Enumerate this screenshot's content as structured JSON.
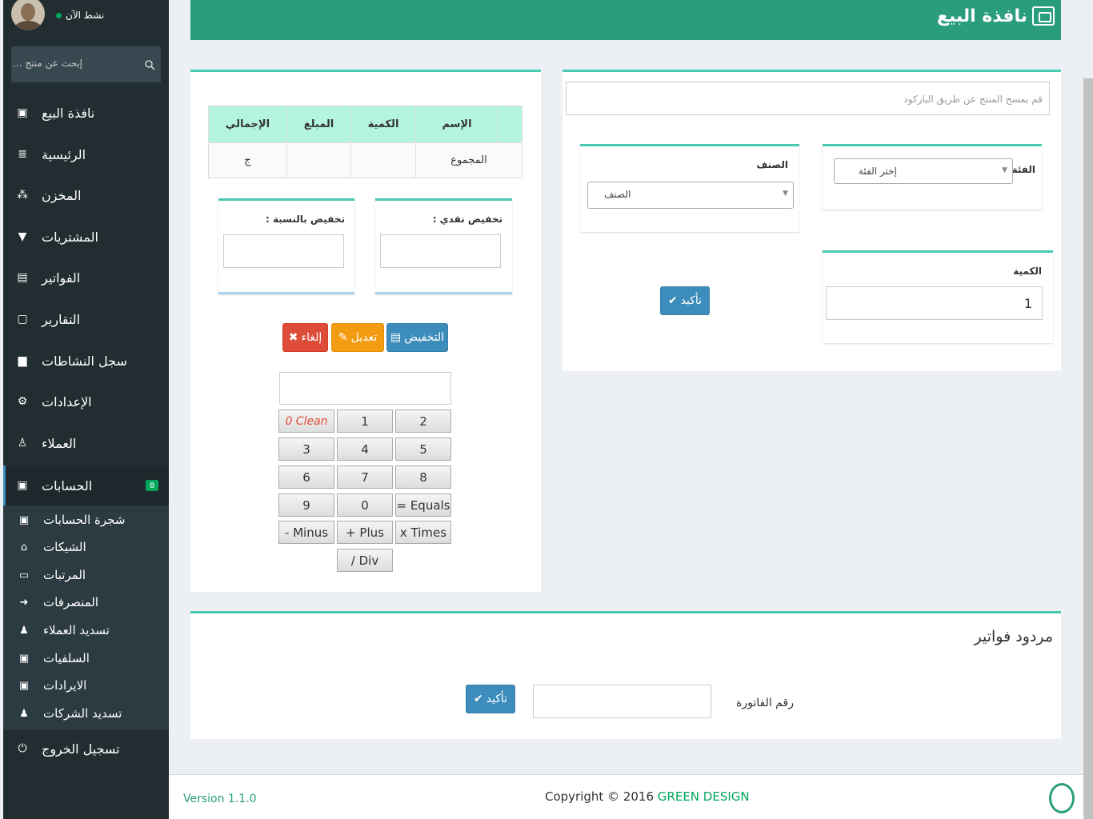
{
  "user": {
    "status": "نشط الآن"
  },
  "sidebar": {
    "search_placeholder": "إبحث عن منتج ...",
    "items": [
      {
        "label": "نافذة البيع",
        "icon": "register-icon"
      },
      {
        "label": "الرئيسية",
        "icon": "list-icon"
      },
      {
        "label": "المخزن",
        "icon": "boxes-icon"
      },
      {
        "label": "المشتريات",
        "icon": "cart-icon"
      },
      {
        "label": "الفواتير",
        "icon": "invoice-icon"
      },
      {
        "label": "التقارير",
        "icon": "file-icon"
      },
      {
        "label": "سجل النشاطات",
        "icon": "file-text-icon"
      },
      {
        "label": "الإعدادات",
        "icon": "gears-icon"
      },
      {
        "label": "العملاء",
        "icon": "person-icon"
      },
      {
        "label": "الحسابات",
        "icon": "money-icon",
        "badge": "8"
      }
    ],
    "sub_items": [
      {
        "label": "شجرة الحسابات",
        "icon": "money-icon"
      },
      {
        "label": "الشيكات",
        "icon": "bank-icon"
      },
      {
        "label": "المرتبات",
        "icon": "card-icon"
      },
      {
        "label": "المنصرفات",
        "icon": "sign-out-icon"
      },
      {
        "label": "تسديد العملاء",
        "icon": "users-icon"
      },
      {
        "label": "السلفيات",
        "icon": "money-icon"
      },
      {
        "label": "الايرادات",
        "icon": "money-icon"
      },
      {
        "label": "تسديد الشركات",
        "icon": "users-icon"
      }
    ],
    "logout": {
      "label": "تسجيل الخروج",
      "icon": "power-icon"
    }
  },
  "header": {
    "title": "نافذة البيع"
  },
  "sale": {
    "barcode_placeholder": "قم بمسح المنتج عن طريق الباركود",
    "category_label": "الفئة",
    "category_value": "إختر الفئة",
    "item_label": "الصنف",
    "item_value": "الصنف",
    "quantity_label": "الكمية",
    "quantity_value": "1",
    "confirm_label": "تأكيد"
  },
  "cart": {
    "headers": [
      "الإسم",
      "الكمية",
      "المبلغ",
      "الإجمالي"
    ],
    "total_label": "المجموع",
    "total_value": "ج",
    "discount_cash_label": "تخفيض نقدي :",
    "discount_percent_label": "تخفيض بالنسبة :",
    "btn_discount": "التخفيض",
    "btn_edit": "تعديل",
    "btn_cancel": "إلغاء"
  },
  "calculator": {
    "rows": [
      [
        "0 Clean",
        "1",
        "2"
      ],
      [
        "3",
        "4",
        "5"
      ],
      [
        "6",
        "7",
        "8"
      ],
      [
        "9",
        "0",
        "= Equals"
      ],
      [
        "- Minus",
        "+ Plus",
        "x Times"
      ],
      [
        "",
        "/ Div",
        ""
      ]
    ]
  },
  "returns": {
    "title": "مردود فواتير",
    "invoice_label": "رقم الفاتورة",
    "confirm_label": "تأكيد"
  },
  "footer": {
    "version": "Version 1.1.0",
    "copyright": "Copyright © 2016",
    "brand": "GREEN DESIGN"
  },
  "colors": {
    "primary": "#2a9d7c",
    "accent": "#48c9b0",
    "sidebar": "#222d32"
  }
}
